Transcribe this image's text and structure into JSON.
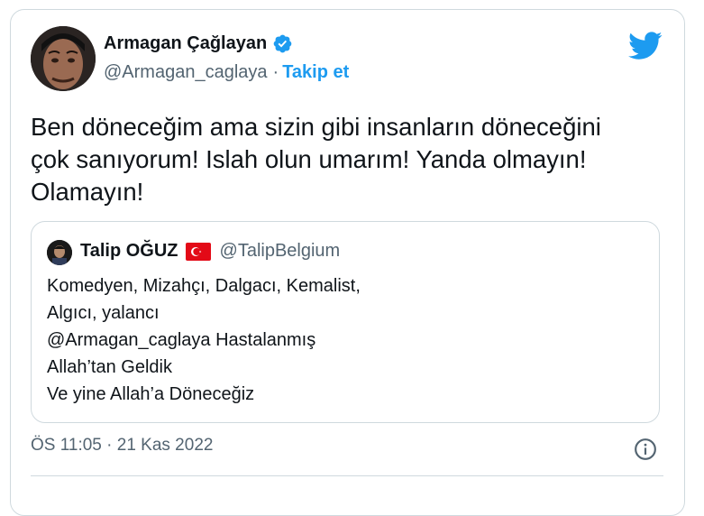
{
  "author": {
    "name": "Armagan Çağlayan",
    "handle": "@Armagan_caglaya",
    "separator": "·",
    "follow_label": "Takip et"
  },
  "tweet": {
    "lines": [
      "Ben döneceğim ama sizin gibi insanların döneceğini",
      "çok sanıyorum! Islah olun umarım! Yanda olmayın!",
      "Olamayın!"
    ]
  },
  "quote": {
    "name": "Talip OĞUZ",
    "handle": "@TalipBelgium",
    "lines": [
      "Komedyen, Mizahçı, Dalgacı, Kemalist,",
      "Algıcı, yalancı",
      "@Armagan_caglaya Hastalanmış",
      "Allah’tan Geldik",
      "Ve yine Allah’a Döneceğiz"
    ]
  },
  "meta": {
    "timestamp": "ÖS 11:05 · 21 Kas 2022"
  },
  "icons": {
    "verified": "verified-badge-icon",
    "brand": "twitter-bird-icon",
    "info": "info-icon",
    "flag": "turkey-flag-icon"
  },
  "colors": {
    "accent": "#1d9bf0",
    "text": "#0f1419",
    "muted": "#536471",
    "border": "#cfd9de",
    "flag_red": "#e30a17"
  }
}
